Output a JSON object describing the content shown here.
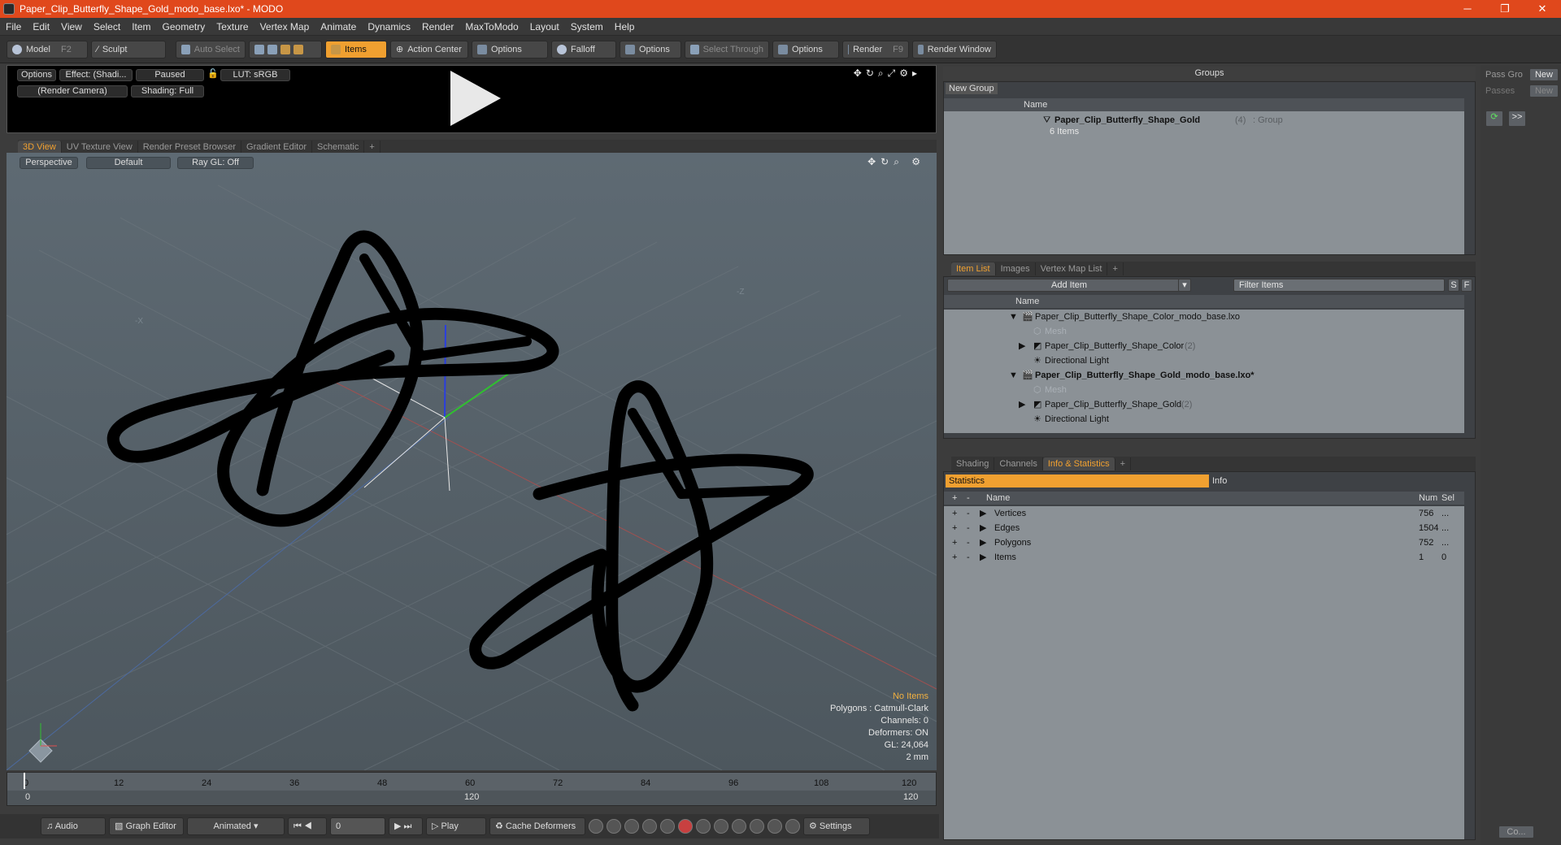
{
  "window": {
    "title": "Paper_Clip_Butterfly_Shape_Gold_modo_base.lxo* - MODO",
    "min": "─",
    "restore": "❐",
    "close": "✕"
  },
  "menu": [
    "File",
    "Edit",
    "View",
    "Select",
    "Item",
    "Geometry",
    "Texture",
    "Vertex Map",
    "Animate",
    "Dynamics",
    "Render",
    "MaxToModo",
    "Layout",
    "System",
    "Help"
  ],
  "toolbar": {
    "model": "Model",
    "model_key": "F2",
    "sculpt": "Sculpt",
    "auto_select": "Auto Select",
    "items": "Items",
    "action_center": "Action Center",
    "options1": "Options",
    "falloff": "Falloff",
    "options2": "Options",
    "select_through": "Select Through",
    "options3": "Options",
    "render": "Render",
    "render_key": "F9",
    "render_window": "Render Window"
  },
  "render_preview": {
    "options": "Options",
    "effect": "Effect: (Shadi...",
    "paused": "Paused",
    "lut": "LUT: sRGB",
    "camera": "(Render Camera)",
    "shading": "Shading: Full"
  },
  "viewport_tabs": [
    "3D View",
    "UV Texture View",
    "Render Preset Browser",
    "Gradient Editor",
    "Schematic",
    "+"
  ],
  "viewport": {
    "projection": "Perspective",
    "style": "Default",
    "raygl": "Ray GL: Off",
    "axis_x": "-X",
    "axis_z": "-Z",
    "hud": {
      "selection": "No Items",
      "polygons": "Polygons : Catmull-Clark",
      "channels": "Channels: 0",
      "deformers": "Deformers: ON",
      "gl": "GL: 24,064",
      "scale": "2 mm"
    }
  },
  "timeline": {
    "ticks": [
      "0",
      "12",
      "24",
      "36",
      "48",
      "60",
      "72",
      "84",
      "96",
      "108",
      "120"
    ],
    "start": "0",
    "mid": "120",
    "end": "120"
  },
  "bottombar": {
    "audio": "Audio",
    "graph_editor": "Graph Editor",
    "animated": "Animated",
    "frame": "0",
    "play": "Play",
    "cache": "Cache Deformers",
    "settings": "Settings"
  },
  "groups": {
    "title": "Groups",
    "new_group": "New Group",
    "col_name": "Name",
    "item_name": "Paper_Clip_Butterfly_Shape_Gold",
    "item_count": "(4)",
    "item_type": ": Group",
    "item_sub": "6 Items"
  },
  "passes": {
    "pass_groups": "Pass Gro",
    "new1": "New",
    "passes": "Passes",
    "new2": "New",
    "more": ">>",
    "co": "Co..."
  },
  "itemlist_tabs": [
    "Item List",
    "Images",
    "Vertex Map List",
    "+"
  ],
  "itemlist": {
    "add_item": "Add Item",
    "filter": "Filter Items",
    "s": "S",
    "f": "F",
    "col_name": "Name",
    "rows": [
      {
        "label": "Paper_Clip_Butterfly_Shape_Color_modo_base.lxo",
        "count": ""
      },
      {
        "label": "Mesh",
        "count": ""
      },
      {
        "label": "Paper_Clip_Butterfly_Shape_Color",
        "count": "(2)"
      },
      {
        "label": "Directional Light",
        "count": ""
      },
      {
        "label": "Paper_Clip_Butterfly_Shape_Gold_modo_base.lxo*",
        "count": ""
      },
      {
        "label": "Mesh",
        "count": ""
      },
      {
        "label": "Paper_Clip_Butterfly_Shape_Gold",
        "count": "(2)"
      },
      {
        "label": "Directional Light",
        "count": ""
      }
    ]
  },
  "stats_tabs": [
    "Shading",
    "Channels",
    "Info & Statistics",
    "+"
  ],
  "stats": {
    "statistics": "Statistics",
    "info": "Info",
    "col_name": "Name",
    "col_num": "Num",
    "col_sel": "Sel",
    "rows": [
      {
        "name": "Vertices",
        "num": "756",
        "sel": "..."
      },
      {
        "name": "Edges",
        "num": "1504",
        "sel": "..."
      },
      {
        "name": "Polygons",
        "num": "752",
        "sel": "..."
      },
      {
        "name": "Items",
        "num": "1",
        "sel": "0"
      }
    ]
  },
  "colors": {
    "title_bar": "#e0481c",
    "accent": "#f0a030",
    "viewport": "#58646c",
    "panel": "#8b9196",
    "clip": "#000000"
  }
}
